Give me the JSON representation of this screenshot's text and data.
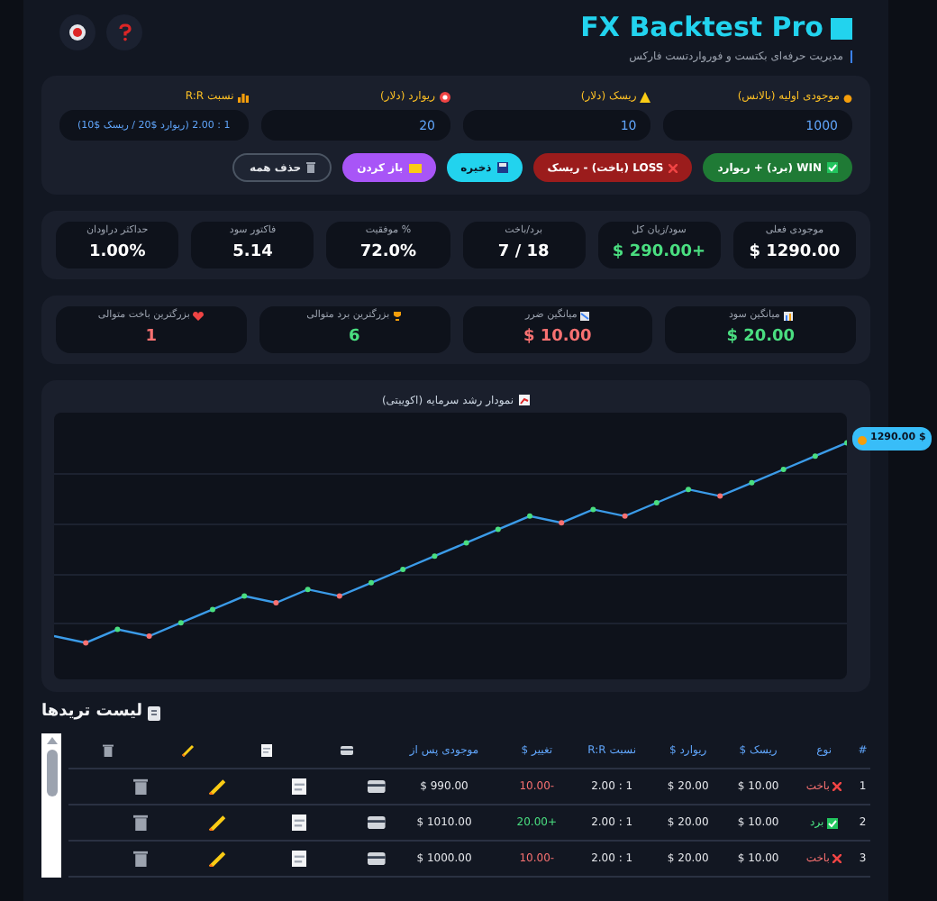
{
  "header": {
    "title": "FX Backtest Pro",
    "subtitle": "مدیریت حرفه‌ای بکتست و فورواردتست فارکس"
  },
  "inputs": [
    {
      "label": "موجودی اولیه (بالانس)",
      "value": "1000"
    },
    {
      "label": "ریسک (دلار)",
      "value": "10"
    },
    {
      "label": "ریوارد (دلار)",
      "value": "20"
    },
    {
      "label": "نسبت R:R",
      "value": "1 : 2.00 (ریوارد $20 / ریسک $10)"
    }
  ],
  "buttons": [
    {
      "kind": "win",
      "label": "WIN (برد) + ریوارد"
    },
    {
      "kind": "loss",
      "label": "LOSS (باخت) - ریسک"
    },
    {
      "kind": "save",
      "label": "ذخیره"
    },
    {
      "kind": "open",
      "label": "باز کردن"
    },
    {
      "kind": "clear",
      "label": "حذف همه"
    }
  ],
  "stats": [
    {
      "label": "موجودی فعلی",
      "value": "$ 1290.00",
      "color": "#ffffff"
    },
    {
      "label": "سود/زیان کل",
      "value": "$ 290.00+",
      "color": "#4ade80"
    },
    {
      "label": "برد/باخت",
      "value": "7 / 18",
      "color": "#ffffff"
    },
    {
      "label": "% موفقیت",
      "value": "72.0%",
      "color": "#ffffff"
    },
    {
      "label": "فاکتور سود",
      "value": "5.14",
      "color": "#ffffff"
    },
    {
      "label": "حداکثر دراودان",
      "value": "1.00%",
      "color": "#ffffff"
    }
  ],
  "averages": [
    {
      "label": "میانگین سود",
      "value": "$ 20.00",
      "color": "#4ade80"
    },
    {
      "label": "میانگین ضرر",
      "value": "$ 10.00",
      "color": "#f87171"
    },
    {
      "label": "بزرگترین برد متوالی",
      "value": "6",
      "color": "#4ade80"
    },
    {
      "label": "بزرگترین باخت متوالی",
      "value": "1",
      "color": "#f87171"
    }
  ],
  "chart": {
    "title": "نمودار رشد سرمایه (اکوییتی)",
    "balance_badge": "1290.00 $"
  },
  "trades": {
    "title": "لیست تریدها",
    "columns": [
      "#",
      "نوع",
      "ریسک $",
      "ریوارد $",
      "نسبت R:R",
      "تغییر $",
      "موجودی پس از"
    ],
    "rows": [
      {
        "number": "1",
        "kind": "loss",
        "type": "باخت",
        "risk": "$ 10.00",
        "reward": "$ 20.00",
        "rr": "2.00 : 1",
        "change": "10.00-",
        "balance_after": "$ 990.00"
      },
      {
        "number": "2",
        "kind": "win",
        "type": "برد",
        "risk": "$ 10.00",
        "reward": "$ 20.00",
        "rr": "2.00 : 1",
        "change": "20.00+",
        "balance_after": "$ 1010.00"
      },
      {
        "number": "3",
        "kind": "loss",
        "type": "باخت",
        "risk": "$ 10.00",
        "reward": "$ 20.00",
        "rr": "2.00 : 1",
        "change": "10.00-",
        "balance_after": "$ 1000.00"
      }
    ]
  }
}
